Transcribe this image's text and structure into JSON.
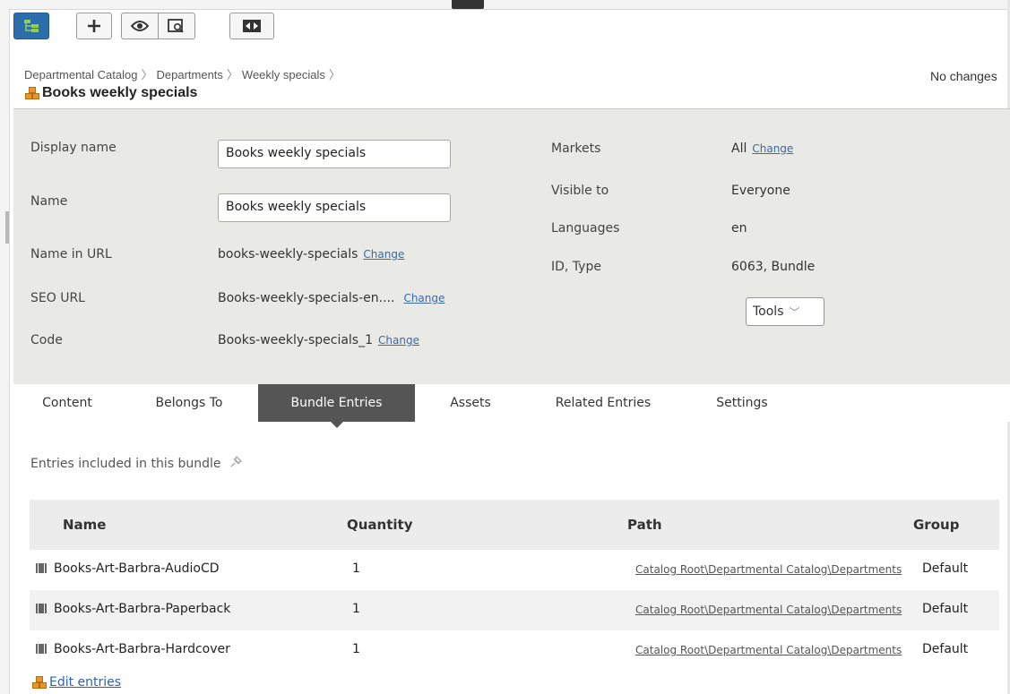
{
  "toolbar": {
    "buttons": [
      {
        "name": "catalog-tree-toggle",
        "icon": "tree-icon",
        "active": true
      },
      {
        "name": "add",
        "icon": "plus-icon"
      },
      {
        "name": "view",
        "icon": "eye-icon"
      },
      {
        "name": "preview",
        "icon": "preview-icon"
      },
      {
        "name": "compare",
        "icon": "compare-icon"
      }
    ]
  },
  "breadcrumb": [
    "Departmental Catalog",
    "Departments",
    "Weekly specials"
  ],
  "page": {
    "title": "Books weekly specials",
    "status": "No changes"
  },
  "properties": {
    "display_name_label": "Display name",
    "display_name_value": "Books weekly specials",
    "name_label": "Name",
    "name_value": "Books weekly specials",
    "name_in_url_label": "Name in URL",
    "name_in_url_value": "books-weekly-specials",
    "seo_url_label": "SEO URL",
    "seo_url_value": "Books-weekly-specials-en....",
    "code_label": "Code",
    "code_value": "Books-weekly-specials_1",
    "change_label": "Change",
    "markets_label": "Markets",
    "markets_value": "All",
    "visible_to_label": "Visible to",
    "visible_to_value": "Everyone",
    "languages_label": "Languages",
    "languages_value": "en",
    "id_type_label": "ID, Type",
    "id_type_value": "6063, Bundle",
    "tools_label": "Tools"
  },
  "tabs": [
    "Content",
    "Belongs To",
    "Bundle Entries",
    "Assets",
    "Related Entries",
    "Settings"
  ],
  "active_tab": "Bundle Entries",
  "bundle": {
    "intro": "Entries included in this bundle",
    "columns": [
      "Name",
      "Quantity",
      "Path",
      "Group"
    ],
    "rows": [
      {
        "name": "Books-Art-Barbra-AudioCD",
        "quantity": "1",
        "path": "Catalog Root\\Departmental Catalog\\Departments",
        "group": "Default"
      },
      {
        "name": "Books-Art-Barbra-Paperback",
        "quantity": "1",
        "path": "Catalog Root\\Departmental Catalog\\Departments",
        "group": "Default"
      },
      {
        "name": "Books-Art-Barbra-Hardcover",
        "quantity": "1",
        "path": "Catalog Root\\Departmental Catalog\\Departments",
        "group": "Default"
      }
    ],
    "edit_label": "Edit entries"
  },
  "colors": {
    "active_toolbar": "#2c6eab",
    "active_tab": "#555555",
    "panel_bg": "#e9e9e5",
    "link": "#2a62b5",
    "bundle_icon": "#e8962a"
  }
}
